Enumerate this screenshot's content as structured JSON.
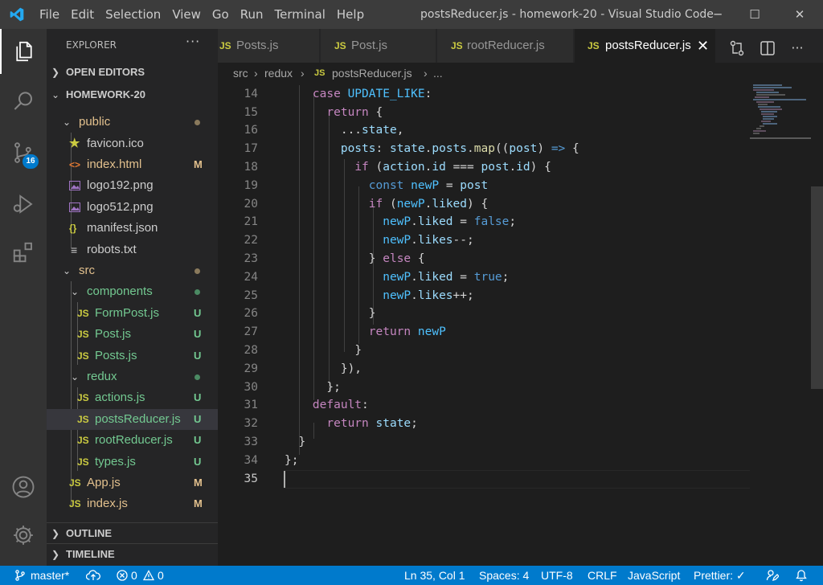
{
  "titlebar": {
    "menu": [
      "File",
      "Edit",
      "Selection",
      "View",
      "Go",
      "Run",
      "Terminal",
      "Help"
    ],
    "window_title": "postsReducer.js - homework-20 - Visual Studio Code",
    "minimize": "─",
    "maximize": "☐",
    "close": "✕"
  },
  "activity": {
    "scm_badge": "16"
  },
  "sidebar": {
    "title": "EXPLORER",
    "more": "···",
    "open_editors": "OPEN EDITORS",
    "workspace": "HOMEWORK-20",
    "outline": "OUTLINE",
    "timeline": "TIMELINE",
    "tree": {
      "public": {
        "label": "public"
      },
      "favicon": {
        "icon": "★",
        "label": "favicon.ico"
      },
      "index_html": {
        "icon": "<>",
        "label": "index.html",
        "status": "M"
      },
      "logo192": {
        "label": "logo192.png"
      },
      "logo512": {
        "label": "logo512.png"
      },
      "manifest": {
        "icon": "{}",
        "label": "manifest.json"
      },
      "robots": {
        "icon": "≡",
        "label": "robots.txt"
      },
      "src": {
        "label": "src"
      },
      "components": {
        "label": "components"
      },
      "formpost": {
        "icon": "JS",
        "label": "FormPost.js",
        "status": "U"
      },
      "post": {
        "icon": "JS",
        "label": "Post.js",
        "status": "U"
      },
      "posts": {
        "icon": "JS",
        "label": "Posts.js",
        "status": "U"
      },
      "redux": {
        "label": "redux"
      },
      "actions": {
        "icon": "JS",
        "label": "actions.js",
        "status": "U"
      },
      "postsreducer": {
        "icon": "JS",
        "label": "postsReducer.js",
        "status": "U"
      },
      "rootreducer": {
        "icon": "JS",
        "label": "rootReducer.js",
        "status": "U"
      },
      "types": {
        "icon": "JS",
        "label": "types.js",
        "status": "U"
      },
      "app": {
        "icon": "JS",
        "label": "App.js",
        "status": "M"
      },
      "index_js": {
        "icon": "JS",
        "label": "index.js",
        "status": "M"
      }
    }
  },
  "tabs": [
    {
      "icon": "JS",
      "label": "Posts.js"
    },
    {
      "icon": "JS",
      "label": "Post.js"
    },
    {
      "icon": "JS",
      "label": "rootReducer.js"
    },
    {
      "icon": "JS",
      "label": "postsReducer.js",
      "close": "✕"
    }
  ],
  "breadcrumb": {
    "parts": [
      "src",
      "redux",
      "postsReducer.js",
      "..."
    ],
    "sep": "›",
    "icon": "JS"
  },
  "editor": {
    "line_numbers": [
      "14",
      "15",
      "16",
      "17",
      "18",
      "19",
      "20",
      "21",
      "22",
      "23",
      "24",
      "25",
      "26",
      "27",
      "28",
      "29",
      "30",
      "31",
      "32",
      "33",
      "34",
      "35"
    ]
  },
  "statusbar": {
    "branch": "master*",
    "errors": "0",
    "warnings": "0",
    "position": "Ln 35, Col 1",
    "spaces": "Spaces: 4",
    "encoding": "UTF-8",
    "eol": "CRLF",
    "language": "JavaScript",
    "prettier": "Prettier: ✓"
  },
  "colors": {
    "accent": "#007acc",
    "modified": "#e2c08d",
    "untracked": "#73c991",
    "js_icon": "#cbcb41"
  }
}
